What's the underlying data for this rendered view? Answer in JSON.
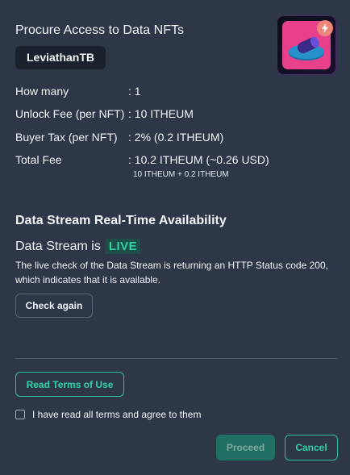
{
  "header": {
    "title": "Procure Access to Data NFTs",
    "nft_name": "LeviathanTB"
  },
  "details": [
    {
      "label": "How many",
      "value": ": 1"
    },
    {
      "label": "Unlock Fee (per NFT)",
      "value": ": 10 ITHEUM"
    },
    {
      "label": "Buyer Tax (per NFT)",
      "value": ": 2% (0.2 ITHEUM)"
    },
    {
      "label": "Total Fee",
      "value": ": 10.2 ITHEUM (~0.26 USD)"
    }
  ],
  "total_breakdown": "10 ITHEUM + 0.2 ITHEUM",
  "availability": {
    "heading": "Data Stream Real-Time Availability",
    "status_prefix": "Data Stream is",
    "status": "LIVE",
    "description": "The live check of the Data Stream is returning an HTTP Status code 200, which indicates that it is available.",
    "check_again_label": "Check again"
  },
  "terms": {
    "read_terms_label": "Read Terms of Use",
    "agree_label": "I have read all terms and agree to them",
    "agreed": false
  },
  "actions": {
    "proceed_label": "Proceed",
    "cancel_label": "Cancel"
  },
  "colors": {
    "background": "#2d3748",
    "accent": "#2fd3a6",
    "live_bg": "#1d4e48",
    "thumb_pink": "#e9408b"
  },
  "icons": {
    "thumbnail": "nft-thumbnail-image",
    "badge": "lightning-bolt-icon"
  }
}
